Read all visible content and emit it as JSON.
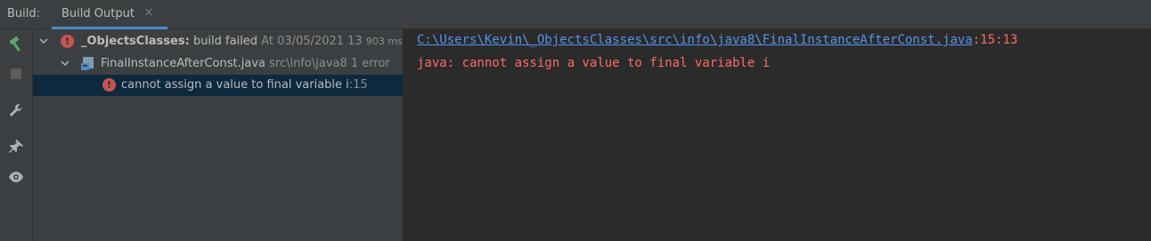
{
  "tabbar": {
    "build_label": "Build:",
    "tab_label": "Build Output",
    "tab_close": "×"
  },
  "toolbar": {
    "icons": [
      "hammer-icon",
      "stop-icon",
      "wrench-icon",
      "pin-icon",
      "eye-icon"
    ]
  },
  "tree": {
    "root": {
      "name": "_ObjectsClasses:",
      "status": "build failed",
      "timestamp": "At 03/05/2021 13",
      "duration": "903 ms"
    },
    "file": {
      "name": "FinalInstanceAfterConst.java",
      "path": "src\\info\\java8",
      "count": "1 error"
    },
    "error": {
      "message": "cannot assign a value to final variable i",
      "line": ":15"
    }
  },
  "output": {
    "link": "C:\\Users\\Kevin\\_ObjectsClasses\\src\\info\\java8\\FinalInstanceAfterConst.java",
    "location": ":15:13",
    "message": "java: cannot assign a value to final variable i"
  },
  "colors": {
    "error_red": "#c75450",
    "error_text": "#ff6b68",
    "link_blue": "#5394ec",
    "selection": "#0d293e",
    "hammer_green": "#59a869"
  }
}
